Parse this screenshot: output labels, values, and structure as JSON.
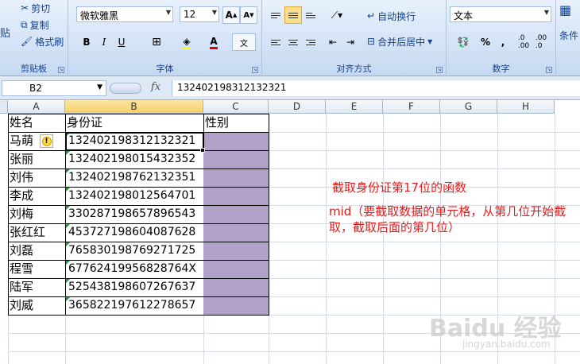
{
  "ribbon": {
    "clipboard": {
      "cut": "剪切",
      "copy": "复制",
      "paste_partial": "贴",
      "format_painter": "格式刷",
      "group_label": "剪贴板"
    },
    "font": {
      "font_name": "微软雅黑",
      "font_size": "12",
      "bold": "B",
      "italic": "I",
      "underline": "U",
      "group_label": "字体"
    },
    "alignment": {
      "wrap_text": "自动换行",
      "merge_center": "合并后居中",
      "group_label": "对齐方式"
    },
    "number": {
      "format": "文本",
      "percent": "%",
      "comma": ",",
      "group_label": "数字"
    },
    "styles": {
      "conditional_partial": "条件"
    }
  },
  "formula_bar": {
    "name_box": "B2",
    "fx": "fx",
    "value": "132402198312132321"
  },
  "columns": [
    "A",
    "B",
    "C",
    "D",
    "E",
    "F",
    "G",
    "H"
  ],
  "selected_column": "B",
  "headers": {
    "name": "姓名",
    "id": "身份证",
    "gender": "性别"
  },
  "rows": [
    {
      "name": "马萌",
      "id": "132402198312132321"
    },
    {
      "name": "张丽",
      "id": "132402198015432352"
    },
    {
      "name": "刘伟",
      "id": "132402198762132351"
    },
    {
      "name": "李成",
      "id": "132402198012564701"
    },
    {
      "name": "刘梅",
      "id": "330287198657896543"
    },
    {
      "name": "张红红",
      "id": "453727198604087628"
    },
    {
      "name": "刘磊",
      "id": "765830198769271725"
    },
    {
      "name": "程雪",
      "id": "67762419956828764X"
    },
    {
      "name": "陆军",
      "id": "525438198607267637"
    },
    {
      "name": "刘威",
      "id": "365822197612278657"
    }
  ],
  "annotation": {
    "line1": "截取身份证第17位的函数",
    "line2": "mid（要截取数据的单元格，从第几位开始截",
    "line3": "取，截取后面的第几位）"
  },
  "watermark": {
    "brand": "Baidu 经验",
    "domain": "jingyan.baidu.com"
  },
  "colors": {
    "fill_purple": "#b1a0c7",
    "annotation_red": "#e81919",
    "ribbon_text": "#15428b"
  }
}
